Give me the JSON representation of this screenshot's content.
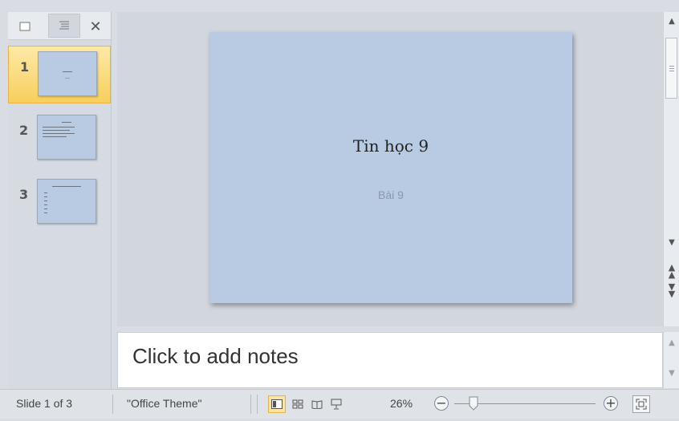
{
  "thumbnails": [
    {
      "number": "1",
      "selected": true
    },
    {
      "number": "2",
      "selected": false
    },
    {
      "number": "3",
      "selected": false
    }
  ],
  "slide": {
    "title": "Tin học 9",
    "subtitle": "Bài 9",
    "background_color": "#b9cbe2"
  },
  "notes": {
    "placeholder": "Click to add notes"
  },
  "statusbar": {
    "slide_indicator": "Slide 1 of 3",
    "theme": "\"Office Theme\"",
    "zoom": "26%",
    "view_buttons": [
      "normal-view-icon",
      "slide-sorter-icon",
      "reading-view-icon",
      "slide-show-icon"
    ],
    "zoom_level_fraction": 0.26
  },
  "colors": {
    "selection_gold": "#f8cf5d",
    "pane_bg": "#d6dbe2"
  }
}
